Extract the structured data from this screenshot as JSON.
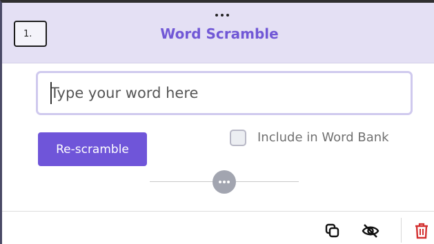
{
  "card": {
    "index_label": "1.",
    "title": "Word Scramble"
  },
  "input": {
    "placeholder": "Type your word here",
    "value": ""
  },
  "actions": {
    "rescramble_label": "Re-scramble",
    "word_bank_label": "Include in Word Bank",
    "word_bank_checked": false
  },
  "footer": {
    "icons": [
      "duplicate-icon",
      "hide-icon",
      "delete-icon"
    ]
  },
  "colors": {
    "accent": "#6f55d9",
    "header_bg": "#e4e0f4",
    "delete": "#d32f2f"
  }
}
